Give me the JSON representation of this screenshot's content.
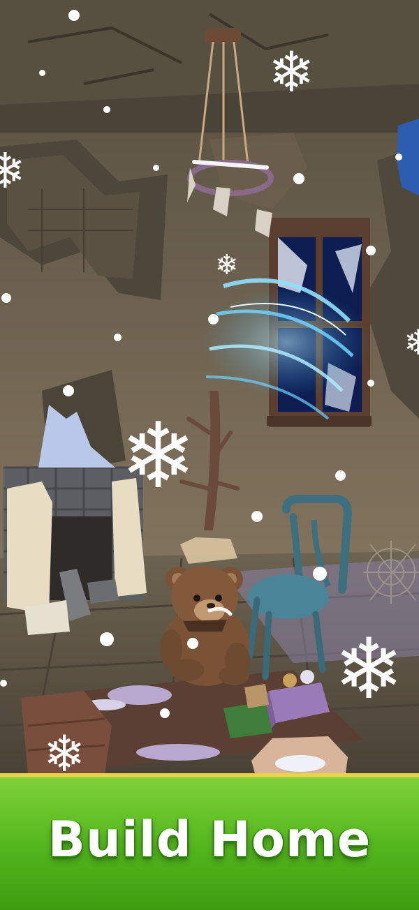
{
  "banner": {
    "title": "Build Home"
  },
  "colors": {
    "wall": "#7d6f57",
    "floor": "#5b5142",
    "banner_green": "#52b51c",
    "banner_border": "#e8d34a",
    "magic_swirl": "#6fd2ff"
  },
  "scene": {
    "objects": [
      "teddy-bear",
      "blue-chair",
      "broken-fireplace",
      "hanging-mobile",
      "broken-window",
      "magic-swirl",
      "bare-tree",
      "toy-box",
      "snowflakes"
    ]
  }
}
